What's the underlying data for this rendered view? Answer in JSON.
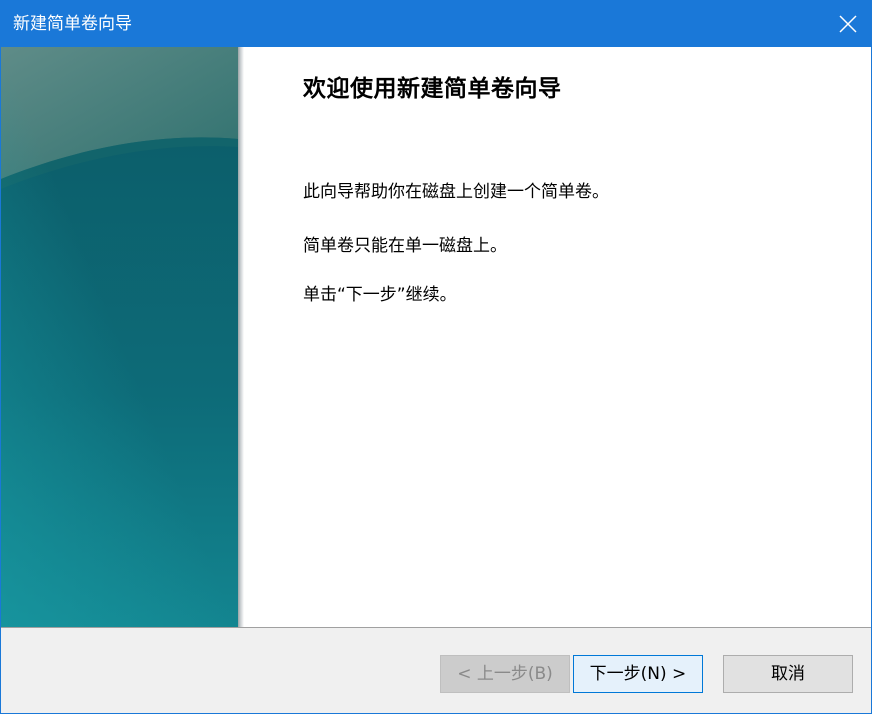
{
  "window": {
    "title": "新建简单卷向导",
    "accent_color": "#1a78d8",
    "close_icon": "close-icon"
  },
  "side_panel": {
    "colors": [
      "#0f6066",
      "#13818a"
    ]
  },
  "main": {
    "title": "欢迎使用新建简单卷向导",
    "paragraphs": [
      "此向导帮助你在磁盘上创建一个简单卷。",
      "简单卷只能在单一磁盘上。",
      "单击“下一步”继续。"
    ]
  },
  "footer": {
    "back_label": "< 上一步(B)",
    "next_label": "下一步(N) >",
    "cancel_label": "取消"
  }
}
